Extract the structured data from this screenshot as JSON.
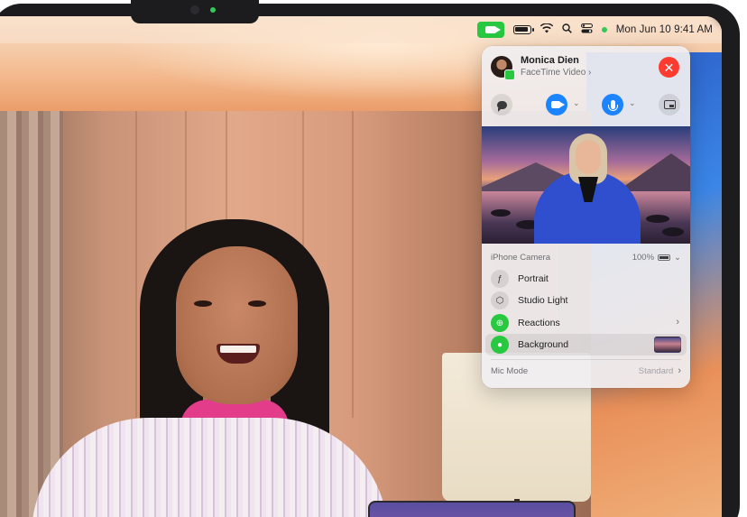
{
  "menubar": {
    "time": "Mon Jun 10  9:41 AM",
    "icons": [
      "facetime-icon",
      "battery-icon",
      "wifi-icon",
      "search-icon",
      "control-center-icon",
      "camera-in-use-dot"
    ]
  },
  "popover": {
    "contact_name": "Monica Dien",
    "call_type": "FaceTime Video",
    "call_type_chevron": "›",
    "end_call_glyph": "✕",
    "controls": {
      "messages_icon": "message-bubble-icon",
      "video_icon": "video-camera-icon",
      "mic_icon": "microphone-icon",
      "share_icon": "screen-share-icon",
      "caret": "⌄"
    },
    "camera_section": {
      "label": "iPhone Camera",
      "battery": "100%",
      "chevron": "⌄"
    },
    "effects": [
      {
        "label": "Portrait",
        "icon": "portrait-f-icon",
        "glyph": "ƒ",
        "active": false
      },
      {
        "label": "Studio Light",
        "icon": "cube-icon",
        "glyph": "⬡",
        "active": false
      },
      {
        "label": "Reactions",
        "icon": "reactions-icon",
        "glyph": "⊕",
        "active": true,
        "chevron": "›"
      },
      {
        "label": "Background",
        "icon": "person-icon",
        "glyph": "●",
        "active": true,
        "selected": true
      }
    ],
    "mic_mode": {
      "label": "Mic Mode",
      "value": "Standard",
      "chevron": "›"
    }
  },
  "colors": {
    "facetime_green": "#28c840",
    "end_call_red": "#ff3b30",
    "accent_blue": "#1c84ff",
    "shirt_pink": "#e23c8a"
  }
}
